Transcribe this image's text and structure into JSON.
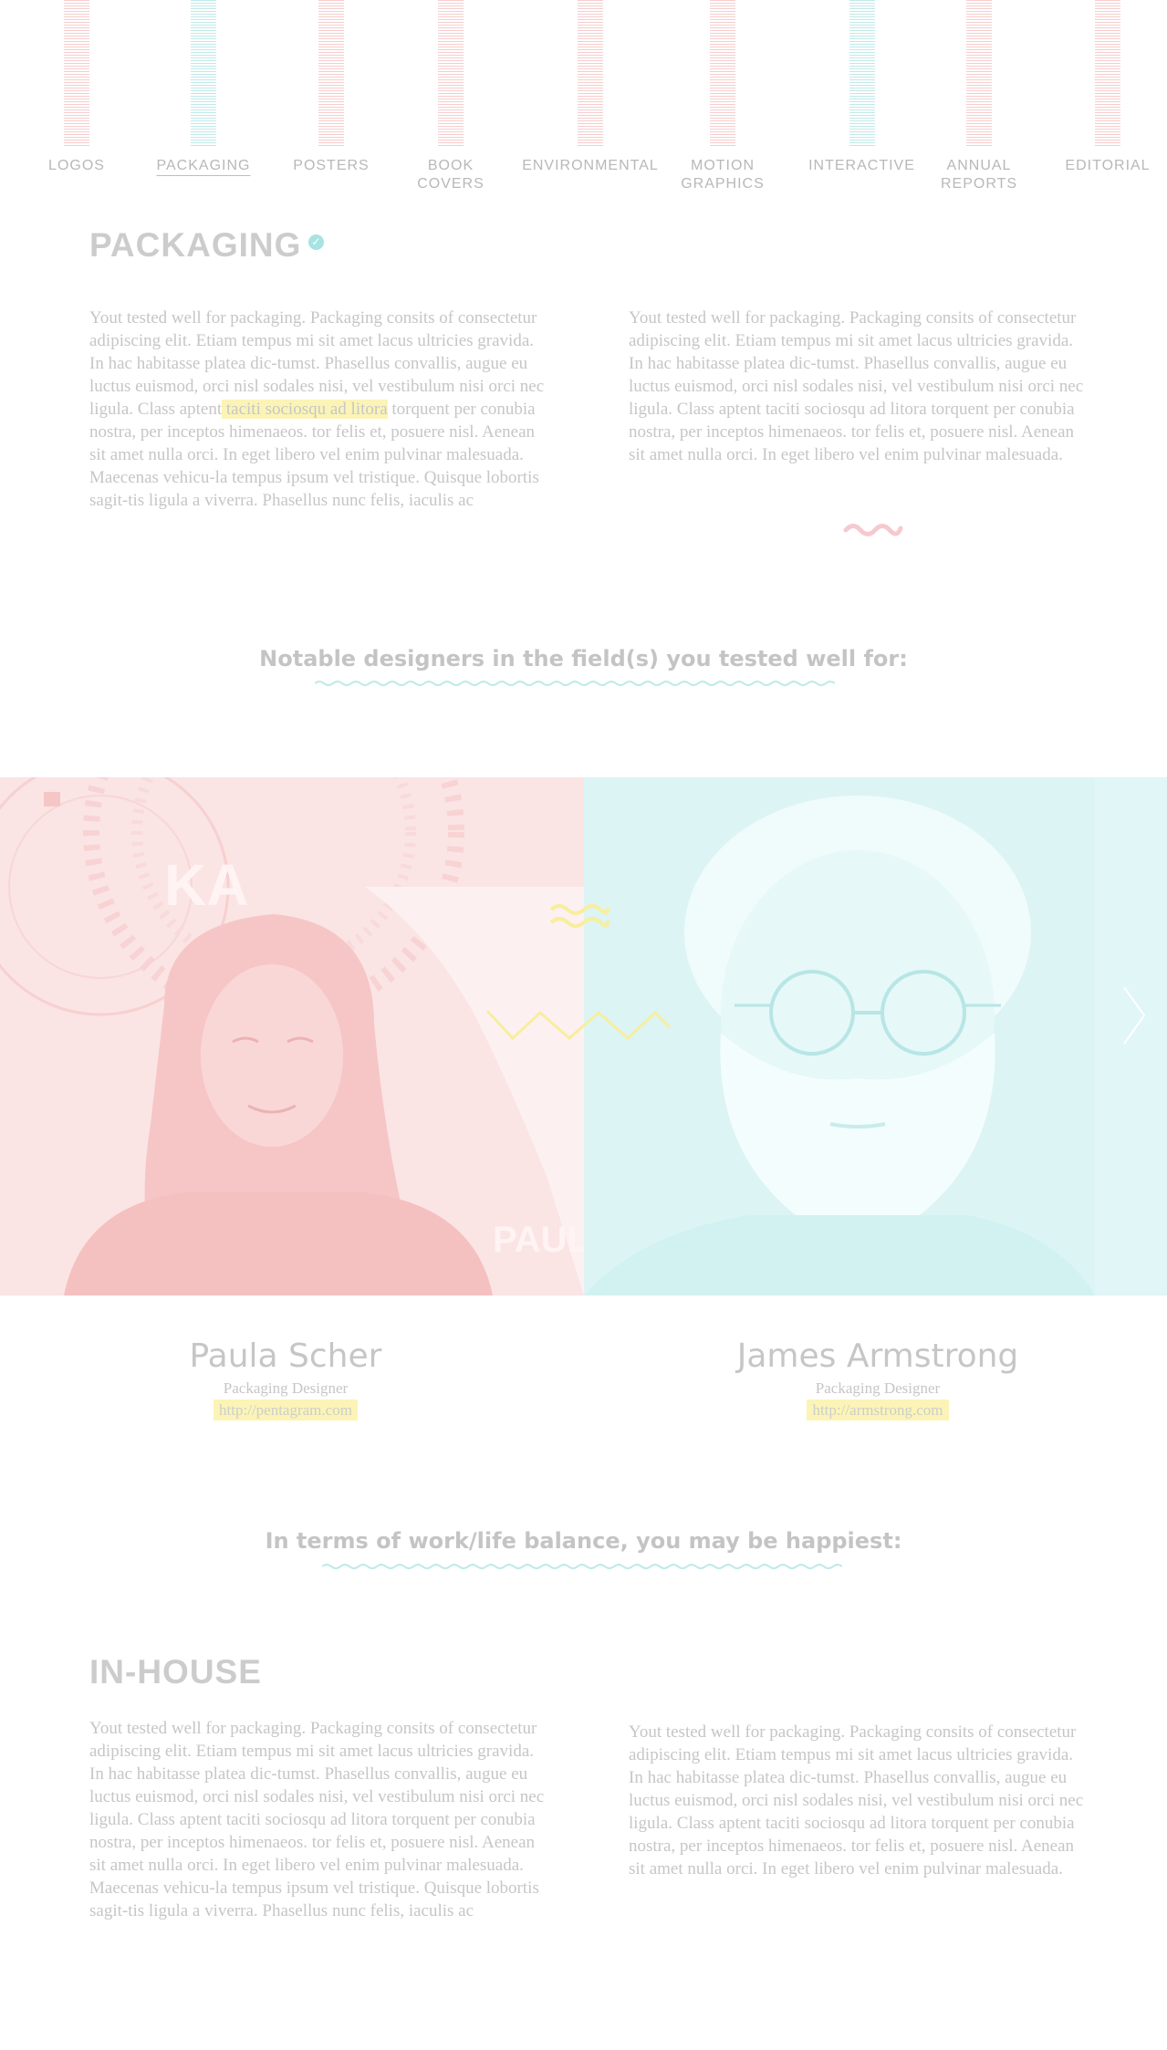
{
  "nav": {
    "items": [
      {
        "label": "LOGOS",
        "color": "#f7cccc",
        "active": false
      },
      {
        "label": "PACKAGING",
        "color": "#bfe9e9",
        "active": true
      },
      {
        "label": "POSTERS",
        "color": "#f7cccc",
        "active": false
      },
      {
        "label": "BOOK\nCOVERS",
        "color": "#f7cccc",
        "active": false
      },
      {
        "label": "ENVIRONMENTAL",
        "color": "#f7cccc",
        "active": false
      },
      {
        "label": "MOTION\nGRAPHICS",
        "color": "#f7cccc",
        "active": false
      },
      {
        "label": "INTERACTIVE",
        "color": "#bfe9e9",
        "active": false
      },
      {
        "label": "ANNUAL\nREPORTS",
        "color": "#f7cccc",
        "active": false
      },
      {
        "label": "EDITORIAL",
        "color": "#f7cccc",
        "active": false
      }
    ]
  },
  "packaging": {
    "heading": "PACKAGING",
    "col1_before": "Yout tested well for packaging. Packaging consits of consectetur adipiscing elit. Etiam tempus mi sit amet lacus ultricies gravida. In hac habitasse platea dic-tumst. Phasellus convallis, augue eu luctus euismod, orci nisl sodales nisi, vel vestibulum nisi orci nec ligula. Class aptent",
    "col1_highlight": " taciti sociosqu ad litora",
    "col1_after": " torquent per conubia nostra, per inceptos himenaeos. tor felis et, posuere nisl. Aenean sit amet nulla orci. In eget libero vel enim pulvinar malesuada. Maecenas vehicu-la tempus ipsum vel tristique. Quisque lobortis sagit-tis ligula a viverra. Phasellus nunc felis, iaculis ac",
    "col2": "Yout tested well for packaging. Packaging consits of consectetur adipiscing elit. Etiam tempus mi sit amet lacus ultricies gravida. In hac habitasse platea dic-tumst. Phasellus convallis, augue eu luctus euismod, orci nisl sodales nisi, vel vestibulum nisi orci nec ligula. Class aptent taciti sociosqu ad litora torquent per conubia nostra, per inceptos himenaeos. tor felis et, posuere nisl. Aenean sit amet nulla orci. In eget libero vel enim pulvinar malesuada."
  },
  "designers_section": {
    "title": "Notable designers in the field(s) you tested well for:"
  },
  "designers": [
    {
      "name": "Paula Scher",
      "role": "Packaging Designer",
      "url": "http://pentagram.com"
    },
    {
      "name": "James Armstrong",
      "role": "Packaging Designer",
      "url": "http://armstrong.com"
    }
  ],
  "balance_section": {
    "title": "In terms of work/life balance, you may be happiest:"
  },
  "inhouse": {
    "heading": "IN-HOUSE",
    "col1": "Yout tested well for packaging. Packaging consits of consectetur adipiscing elit. Etiam tempus mi sit amet lacus ultricies gravida. In hac habitasse platea dic-tumst. Phasellus convallis, augue eu luctus euismod, orci nisl sodales nisi, vel vestibulum nisi orci nec ligula. Class aptent taciti sociosqu ad litora torquent per conubia nostra, per inceptos himenaeos. tor felis et, posuere nisl. Aenean sit amet nulla orci. In eget libero vel enim pulvinar malesuada. Maecenas vehicu-la tempus ipsum vel tristique. Quisque lobortis sagit-tis ligula a viverra. Phasellus nunc felis, iaculis ac",
    "col2": "Yout tested well for packaging. Packaging consits of consectetur adipiscing elit. Etiam tempus mi sit amet lacus ultricies gravida. In hac habitasse platea dic-tumst. Phasellus convallis, augue eu luctus euismod, orci nisl sodales nisi, vel vestibulum nisi orci nec ligula. Class aptent taciti sociosqu ad litora torquent per conubia nostra, per inceptos himenaeos. tor felis et, posuere nisl. Aenean sit amet nulla orci. In eget libero vel enim pulvinar malesuada."
  },
  "colors": {
    "pink": "#fbe4e4",
    "teal": "#dcf4f4",
    "highlight": "#fbf4b6"
  }
}
